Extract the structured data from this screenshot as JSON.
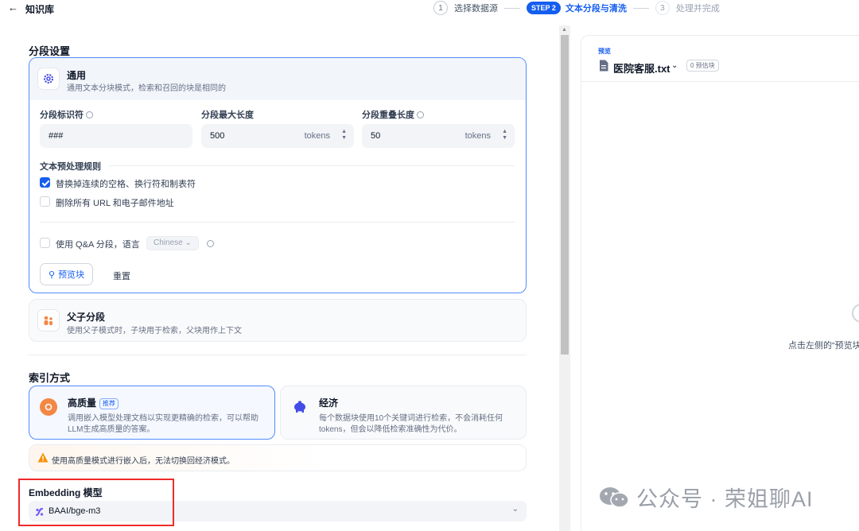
{
  "header": {
    "back_icon": "arrow-left-icon",
    "title": "知识库",
    "steps": [
      {
        "num": "1",
        "label": "选择数据源"
      },
      {
        "badge": "STEP 2",
        "label": "文本分段与清洗"
      },
      {
        "num": "3",
        "label": "处理并完成"
      }
    ]
  },
  "segment": {
    "title": "分段设置",
    "general": {
      "icon": "gear-icon",
      "title": "通用",
      "desc": "通用文本分块模式，检索和召回的块是相同的",
      "separator_label": "分段标识符",
      "separator_value": "###",
      "max_len_label": "分段最大长度",
      "max_len_value": "500",
      "overlap_label": "分段重叠长度",
      "overlap_value": "50",
      "unit": "tokens",
      "preprocess_title": "文本预处理规则",
      "rule1": "替换掉连续的空格、换行符和制表符",
      "rule1_checked": true,
      "rule2": "删除所有 URL 和电子邮件地址",
      "rule2_checked": false,
      "qa_label": "使用 Q&A 分段，语言",
      "qa_lang": "Chinese",
      "preview_btn": "预览块",
      "reset_btn": "重置"
    },
    "parent_child": {
      "icon": "parent-child-icon",
      "title": "父子分段",
      "desc": "使用父子模式时，子块用于检索，父块用作上下文"
    }
  },
  "index": {
    "title": "索引方式",
    "high": {
      "title": "高质量",
      "badge": "推荐",
      "desc1": "调用嵌入模型处理文档以实现更精确的检索，可以帮助",
      "desc2": "LLM生成高质量的答案。"
    },
    "eco": {
      "title": "经济",
      "desc1": "每个数据块使用10个关键词进行检索，不会消耗任何",
      "desc2": "tokens，但会以降低检索准确性为代价。"
    },
    "warning": "使用高质量模式进行嵌入后，无法切换回经济模式。"
  },
  "embedding": {
    "title": "Embedding 模型",
    "model": "BAAI/bge-m3"
  },
  "preview": {
    "label": "预览",
    "file": "医院客服.txt",
    "count": "0 预估块",
    "hint": "点击左侧的“预览块"
  },
  "watermark": "公众号 · 荣姐聊AI"
}
